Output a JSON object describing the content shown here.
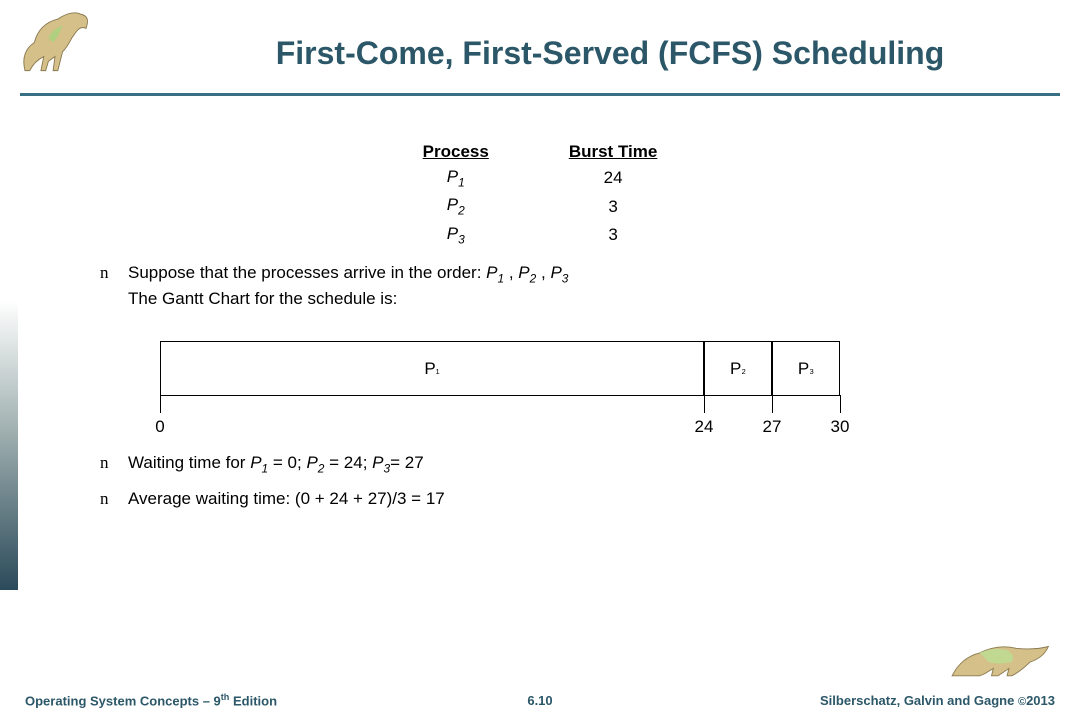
{
  "title": "First-Come, First-Served (FCFS) Scheduling",
  "table": {
    "headers": [
      "Process",
      "Burst Time"
    ],
    "rows": [
      {
        "proc": "P",
        "sub": "1",
        "burst": "24"
      },
      {
        "proc": "P",
        "sub": "2",
        "burst": "3"
      },
      {
        "proc": "P",
        "sub": "3",
        "burst": "3"
      }
    ]
  },
  "bullet1_prefix": "Suppose that the processes arrive in the order: ",
  "bullet1_suffix": "The Gantt Chart for the schedule is:",
  "order": [
    {
      "p": "P",
      "s": "1"
    },
    {
      "p": "P",
      "s": "2"
    },
    {
      "p": "P",
      "s": "3"
    }
  ],
  "sep": " , ",
  "chart_data": {
    "type": "bar",
    "title": "Gantt chart",
    "bars": [
      {
        "label": "P₁",
        "start": 0,
        "end": 24
      },
      {
        "label": "P₂",
        "start": 24,
        "end": 27
      },
      {
        "label": "P₃",
        "start": 27,
        "end": 30
      }
    ],
    "ticks": [
      0,
      24,
      27,
      30
    ],
    "xlim": [
      0,
      30
    ]
  },
  "wait_label": "Waiting time for ",
  "wait_parts": [
    {
      "p": "P",
      "s": "1",
      "eq": " = 0; "
    },
    {
      "p": "P",
      "s": "2",
      "eq": " = 24; "
    },
    {
      "p": "P",
      "s": "3",
      "eq": "= 27"
    }
  ],
  "avg_label": "Average waiting time:  (0 + 24 + 27)/3 = 17",
  "footer": {
    "left_a": "Operating System Concepts – 9",
    "left_sup": "th",
    "left_b": " Edition",
    "center": "6.10",
    "right_a": "Silberschatz, Galvin and Gagne ",
    "right_copy": "©",
    "right_b": "2013"
  }
}
